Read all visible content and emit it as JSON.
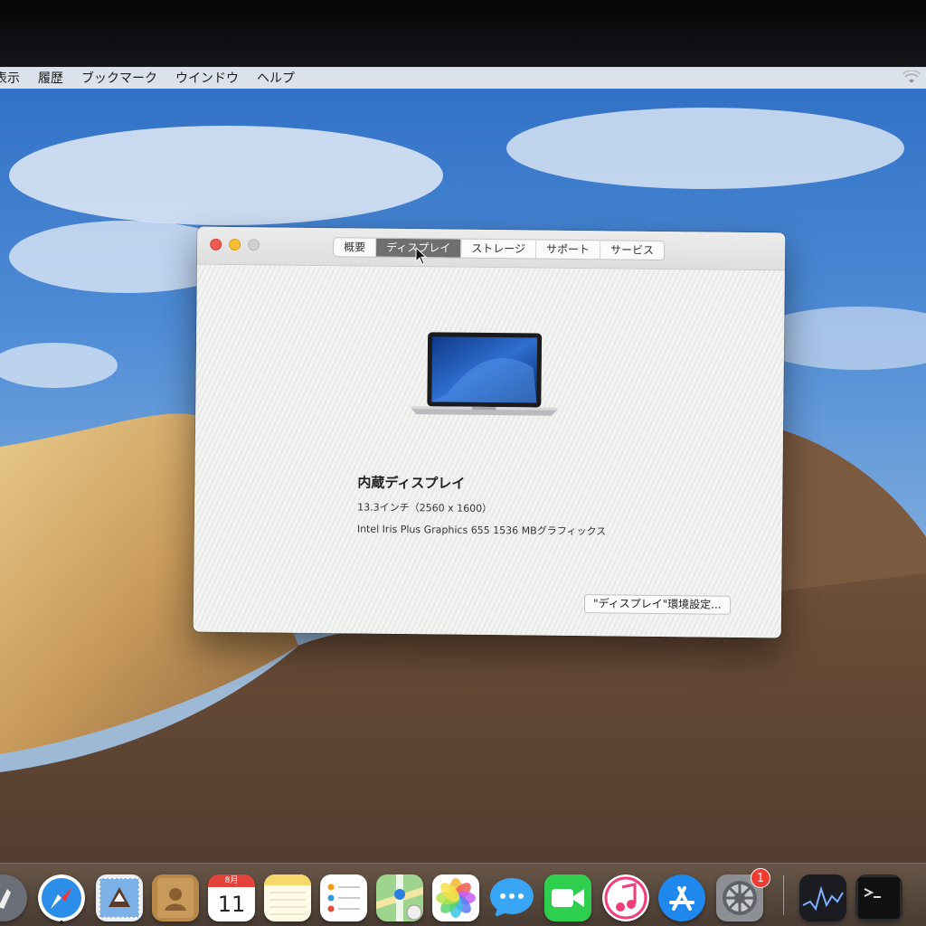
{
  "menubar": {
    "items": [
      "表示",
      "履歴",
      "ブックマーク",
      "ウインドウ",
      "ヘルプ"
    ]
  },
  "about_window": {
    "tabs": [
      {
        "label": "概要",
        "active": false
      },
      {
        "label": "ディスプレイ",
        "active": true
      },
      {
        "label": "ストレージ",
        "active": false
      },
      {
        "label": "サポート",
        "active": false
      },
      {
        "label": "サービス",
        "active": false
      }
    ],
    "display_name": "内蔵ディスプレイ",
    "display_size": "13.3インチ（2560 x 1600）",
    "graphics": "Intel Iris Plus Graphics 655 1536 MBグラフィックス",
    "prefs_button": "\"ディスプレイ\"環境設定..."
  },
  "dock": {
    "calendar_month": "8月",
    "calendar_day": "11",
    "system_prefs_badge": "1",
    "apps": [
      "launchpad",
      "safari",
      "mail",
      "contacts",
      "calendar",
      "notes",
      "reminders",
      "maps",
      "photos",
      "messages",
      "facetime",
      "itunes",
      "app-store",
      "system-preferences",
      "activity-monitor",
      "terminal"
    ]
  },
  "colors": {
    "close": "#ee5b52",
    "minimize": "#f5bf2f",
    "active_tab": "#6f6f6f",
    "badge": "#f23b30"
  }
}
